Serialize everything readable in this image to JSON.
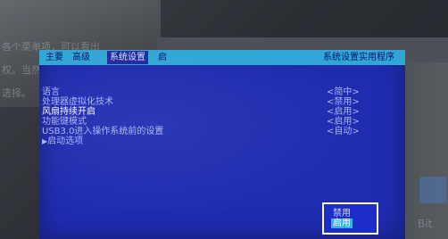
{
  "article": {
    "lines": [
      "各个菜单项，可以看出",
      "权。当然",
      "选择。"
    ]
  },
  "outer": {
    "bottom_right_text": "Bit"
  },
  "bios": {
    "menu": {
      "items": [
        {
          "label": "主要"
        },
        {
          "label": "高级"
        },
        {
          "label": "系统设置"
        },
        {
          "label": "启"
        }
      ],
      "selected_index": 2,
      "right_label": "系统设置实用程序"
    },
    "settings": [
      {
        "label": "语言",
        "value": "<简中>",
        "highlight": false,
        "has_arrow": false
      },
      {
        "label": "处理器虚拟化技术",
        "value": "<禁用>",
        "highlight": false,
        "has_arrow": false
      },
      {
        "label": "风扇持续开启",
        "value": "<启用>",
        "highlight": true,
        "has_arrow": false
      },
      {
        "label": "功能键模式",
        "value": "<启用>",
        "highlight": false,
        "has_arrow": false
      },
      {
        "label": "USB3.0进入操作系统前的设置",
        "value": "<自动>",
        "highlight": false,
        "has_arrow": false
      },
      {
        "label": "启动选项",
        "value": "",
        "highlight": false,
        "has_arrow": true
      }
    ],
    "popup": {
      "options": [
        {
          "label": "禁用"
        },
        {
          "label": "启用"
        }
      ],
      "selected_index": 1
    }
  },
  "colors": {
    "screen_bg": "#1f2cb0",
    "menu_bar": "#2fa6d6",
    "text": "#a9b4f2",
    "highlight_text": "#ffffff",
    "popup_selected": "#3bb0e6"
  }
}
